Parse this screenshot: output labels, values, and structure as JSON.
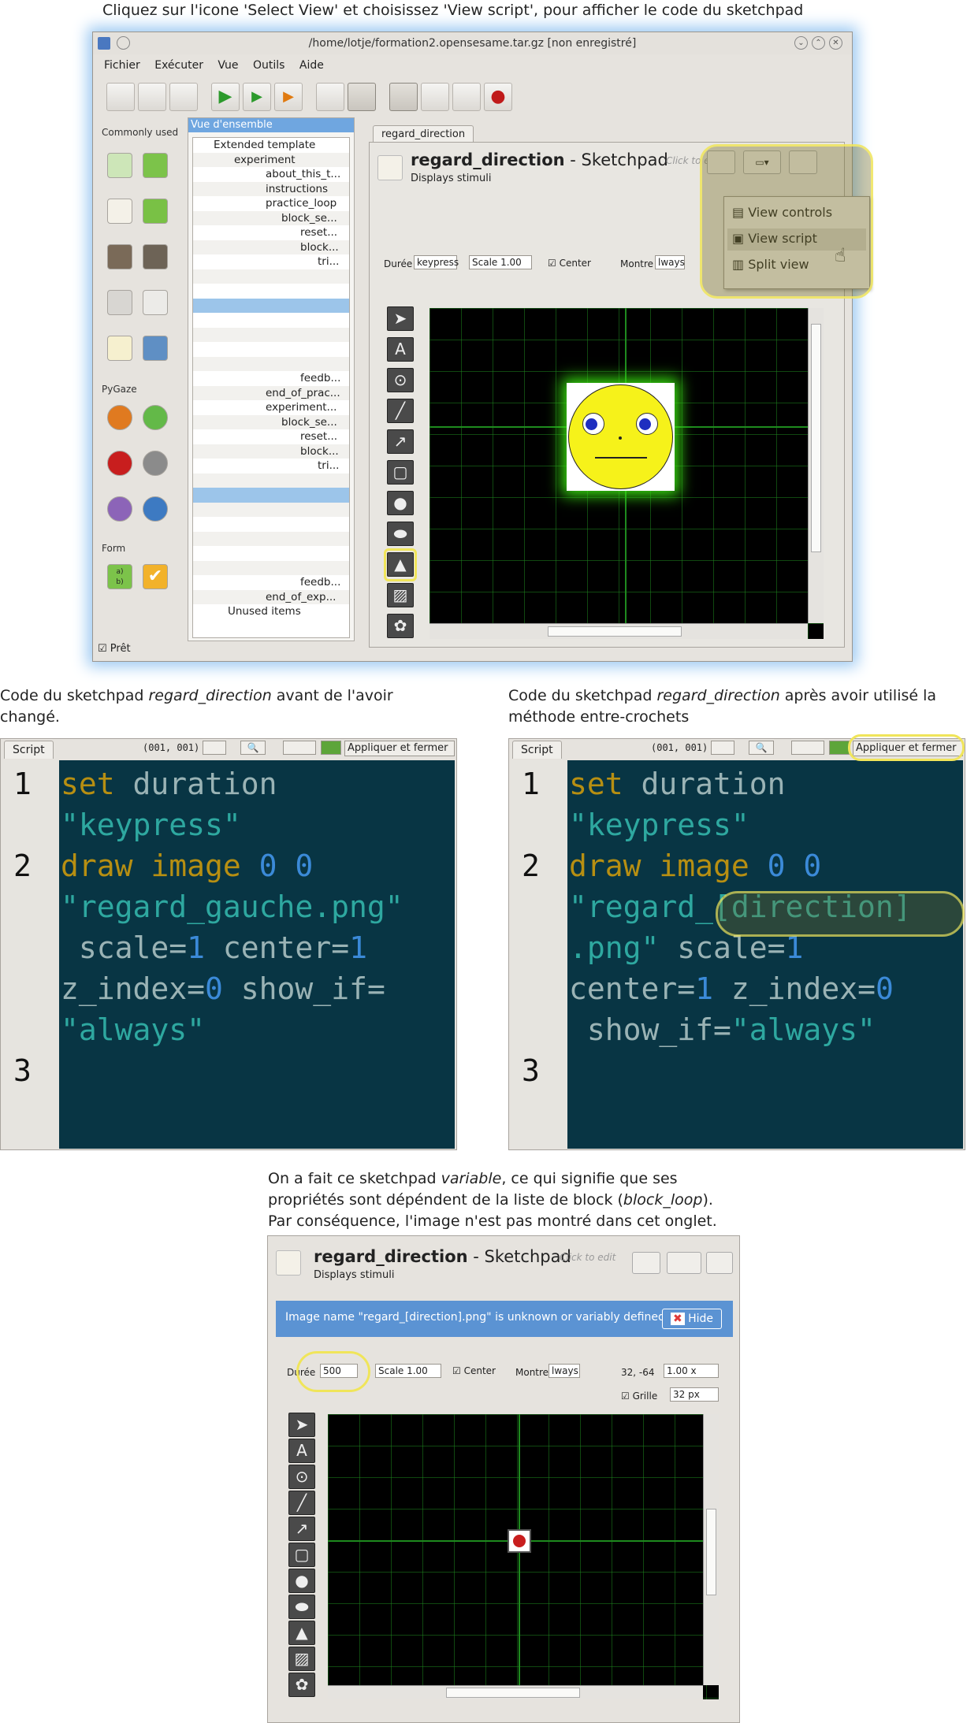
{
  "captions": {
    "top": "Cliquez sur l'icone 'Select View' et choisissez 'View script', pour afficher le code du sketchpad",
    "before_a": "Code du sketchpad ",
    "before_em": "regard_direction",
    "before_b": " avant de l'avoir changé.",
    "after_a": "Code du sketchpad ",
    "after_em": "regard_direction",
    "after_b": "  après avoir utilisé la méthode entre-crochets",
    "var_line1_a": "On a fait ce sketchpad ",
    "var_line1_em": "variable",
    "var_line1_b": ", ce qui signifie que ses",
    "var_line2_a": "propriétés sont dépéndent de la liste de block (",
    "var_line2_em": "block_loop",
    "var_line2_b": ").",
    "var_line3": "Par conséquence, l'image n'est pas montré dans cet onglet."
  },
  "window": {
    "title": "/home/lotje/formation2.opensesame.tar.gz [non enregistré]",
    "menu": [
      "Fichier",
      "Exécuter",
      "Vue",
      "Outils",
      "Aide"
    ],
    "status": "Prêt"
  },
  "sidebar": {
    "commonly_used": "Commonly used",
    "pygaze": "PyGaze",
    "form": "Form"
  },
  "overview": {
    "title": "Vue d'ensemble",
    "items": [
      "Extended template",
      "experiment",
      "about_this_t...",
      "instructions",
      "practice_loop",
      "block_se...",
      "reset...",
      "block...",
      "tri...",
      "",
      "",
      "",
      "",
      "",
      "",
      "",
      "feedb...",
      "end_of_prac...",
      "experiment...",
      "block_se...",
      "reset...",
      "block...",
      "tri...",
      "",
      "",
      "",
      "",
      "",
      "",
      "",
      "feedb...",
      "end_of_exp...",
      "Unused items"
    ]
  },
  "sketchpad": {
    "tab": "regard_direction",
    "name": "regard_direction",
    "type": " - Sketchpad",
    "click_to_edit": "Click to edit",
    "desc": "Displays stimuli",
    "duration_label": "Durée",
    "duration_value": "keypress",
    "scale": "Scale 1.00",
    "center": "Center",
    "show_label": "Montre",
    "show_value": "lways"
  },
  "view_menu": [
    "View controls",
    "View script",
    "Split view"
  ],
  "script_before": {
    "tab": "Script",
    "coords": "(001, 001)",
    "apply": "Appliquer et fermer",
    "lines": [
      "1",
      "2",
      "3"
    ]
  },
  "script_after": {
    "tab": "Script",
    "coords": "(001, 001)",
    "apply": "Appliquer et fermer",
    "lines": [
      "1",
      "2",
      "3"
    ]
  },
  "variable_panel": {
    "name": "regard_direction",
    "type": " - Sketchpad",
    "click_to_edit": "Click to edit",
    "desc": "Displays stimuli",
    "message": "Image name \"regard_[direction].png\" is unknown or variably defined.",
    "hide": "Hide",
    "duration_label": "Durée",
    "duration_value": "500",
    "scale": "Scale 1.00",
    "center": "Center",
    "show_label": "Montre",
    "show_value": "lways",
    "coords": "32, -64",
    "zoom": "1.00 x",
    "grid_label": "Grille",
    "grid_value": "32 px"
  },
  "colors": {
    "accent": "#f0e55a",
    "code_bg": "#083544",
    "selection": "#9cc5ea",
    "info_bar": "#5b93d3"
  }
}
